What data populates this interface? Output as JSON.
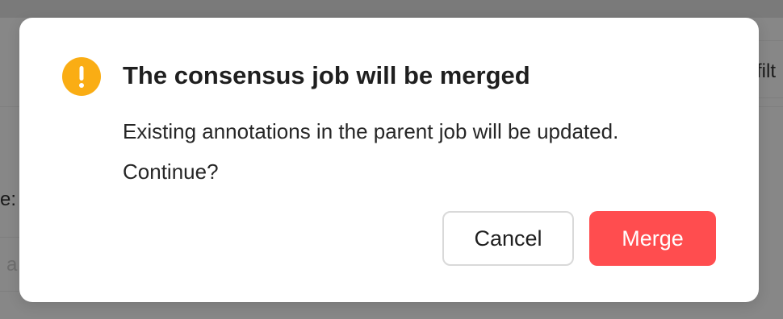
{
  "background": {
    "filter_text": "filt",
    "label_text": "e:",
    "input_text": "a"
  },
  "modal": {
    "icon": "exclamation-circle-icon",
    "title": "The consensus job will be merged",
    "body_line1": "Existing annotations in the parent job will be updated.",
    "body_line2": "Continue?",
    "cancel_label": "Cancel",
    "confirm_label": "Merge"
  },
  "colors": {
    "warning": "#faad14",
    "danger": "#ff4d4f",
    "overlay": "#878787"
  }
}
